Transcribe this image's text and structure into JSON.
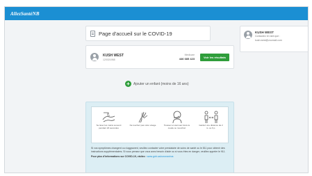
{
  "header": {
    "logo_text": "AllezSantéNB"
  },
  "page": {
    "title": "Page d'accueil sur le COVID-19"
  },
  "user_card": {
    "name": "KUSH WEST",
    "sub": "12/03/1958",
    "medicare_label": "Medicare",
    "medicare_number": "446 685 423",
    "results_button": "Voir les résultats"
  },
  "add_child": {
    "label": "Ajouter un enfant (moins de 16 ans)"
  },
  "account": {
    "name": "KUSH WEST",
    "line1": "Contactez en tant que :",
    "line2": "kush.west@zoomail.com"
  },
  "guidance": {
    "items": [
      {
        "icon": "handwash-icon",
        "caption": "Se laver les mains souvent pendant 20 secondes"
      },
      {
        "icon": "no-touch-face-icon",
        "caption": "Ne touchez pas votre visage"
      },
      {
        "icon": "cough-elbow-icon",
        "caption": "Toussez et éternuez dans le coude ou mouchoir"
      },
      {
        "icon": "distance-icon",
        "caption": "Gardez une distance de 2 m. ou 6 p."
      }
    ],
    "warning": "Si vos symptômes changent ou s'aggravent, veuillez contacter votre prestataire de soins de santé ou le 811 pour obtenir des instructions supplémentaires. Si vous pensez que vous avez besoin d'aide ou si vous êtes en danger, veuillez appeler le 911.",
    "more_prefix": "Pour plus d'informations sur COVID-19, visitez :",
    "more_link": "www.gnb.ca/coronavirus"
  },
  "colors": {
    "topbar": "#1b8fd3",
    "accent_green": "#2f9d3b",
    "info_bg": "#dceef4"
  }
}
